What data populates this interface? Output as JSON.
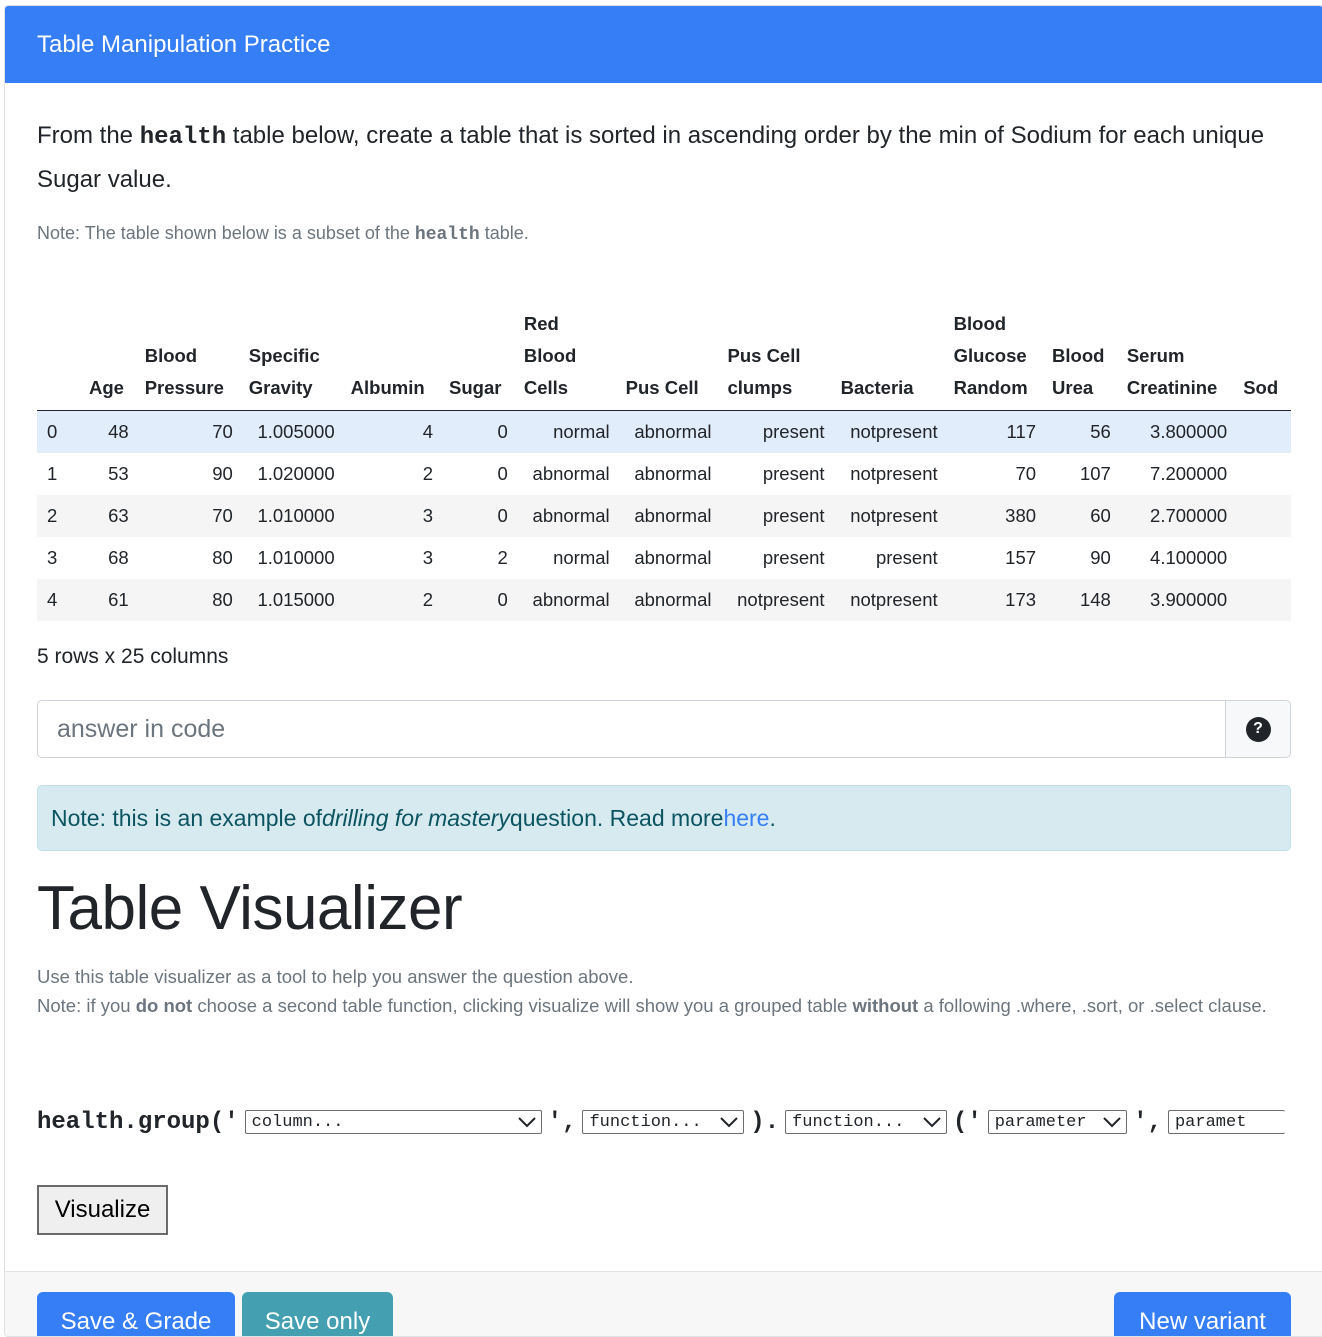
{
  "header": {
    "title": "Table Manipulation Practice"
  },
  "question": {
    "part1": "From the ",
    "table_name": "health",
    "part2": " table below, create a table that is sorted in ascending order by the min of Sodium for each unique Sugar value."
  },
  "subset_note": {
    "prefix": "Note: The table shown below is a subset of the ",
    "table_name": "health",
    "suffix": " table."
  },
  "table": {
    "columns": [
      {
        "lines": [
          ""
        ]
      },
      {
        "lines": [
          "Age"
        ]
      },
      {
        "lines": [
          "Blood",
          "Pressure"
        ]
      },
      {
        "lines": [
          "Specific",
          "Gravity"
        ]
      },
      {
        "lines": [
          "Albumin"
        ]
      },
      {
        "lines": [
          "Sugar"
        ]
      },
      {
        "lines": [
          "Red",
          "Blood",
          "Cells"
        ]
      },
      {
        "lines": [
          "Pus Cell"
        ]
      },
      {
        "lines": [
          "Pus Cell",
          "clumps"
        ]
      },
      {
        "lines": [
          "Bacteria"
        ]
      },
      {
        "lines": [
          "Blood",
          "Glucose",
          "Random"
        ]
      },
      {
        "lines": [
          "Blood",
          "Urea"
        ]
      },
      {
        "lines": [
          "Serum",
          "Creatinine"
        ]
      },
      {
        "lines": [
          "Sod"
        ]
      }
    ],
    "rows": [
      [
        "0",
        "48",
        "70",
        "1.005000",
        "4",
        "0",
        "normal",
        "abnormal",
        "present",
        "notpresent",
        "117",
        "56",
        "3.800000",
        ""
      ],
      [
        "1",
        "53",
        "90",
        "1.020000",
        "2",
        "0",
        "abnormal",
        "abnormal",
        "present",
        "notpresent",
        "70",
        "107",
        "7.200000",
        ""
      ],
      [
        "2",
        "63",
        "70",
        "1.010000",
        "3",
        "0",
        "abnormal",
        "abnormal",
        "present",
        "notpresent",
        "380",
        "60",
        "2.700000",
        ""
      ],
      [
        "3",
        "68",
        "80",
        "1.010000",
        "3",
        "2",
        "normal",
        "abnormal",
        "present",
        "present",
        "157",
        "90",
        "4.100000",
        ""
      ],
      [
        "4",
        "61",
        "80",
        "1.015000",
        "2",
        "0",
        "abnormal",
        "abnormal",
        "notpresent",
        "notpresent",
        "173",
        "148",
        "3.900000",
        ""
      ]
    ],
    "highlighted_row": 0,
    "shape_text": "5 rows x 25 columns"
  },
  "answer": {
    "placeholder": "answer in code",
    "value": "",
    "help_symbol": "?"
  },
  "alert": {
    "prefix": "Note: this is an example of ",
    "emphasis": "drilling for mastery",
    "middle": " question. Read more ",
    "link": "here",
    "suffix": "."
  },
  "visualizer": {
    "title": "Table Visualizer",
    "line1": "Use this table visualizer as a tool to help you answer the question above.",
    "line2_a": "Note: if you ",
    "line2_b": "do not",
    "line2_c": " choose a second table function, clicking visualize will show you a grouped table ",
    "line2_d": "without",
    "line2_e": " a following .where, .sort, or .select clause.",
    "code_prefix": "health.group('",
    "code_sep1": "',",
    "code_sep2": ").",
    "code_sep3": "('",
    "code_sep4": "',",
    "select_column": "column...",
    "select_function1": "function...",
    "select_function2": "function...",
    "select_param1": "parameter",
    "select_param2": "paramet",
    "button": "Visualize"
  },
  "footer": {
    "save_grade": "Save & Grade",
    "save_only": "Save only",
    "new_variant": "New variant"
  },
  "colors": {
    "primary": "#367ef6",
    "info": "#44a0b0",
    "alert_bg": "#d6eaf0",
    "highlight_row": "#e2edfb"
  }
}
